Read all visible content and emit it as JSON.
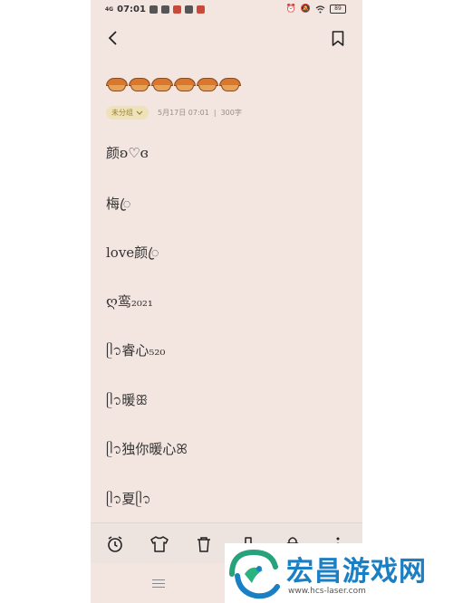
{
  "status_bar": {
    "network": "4G",
    "time": "07:01",
    "battery": "89"
  },
  "note": {
    "folder": "未分组",
    "date": "5月17日 07:01",
    "separator": "|",
    "word_count": "300字",
    "lines": [
      "颜ʚ♡ɞ",
      "梅ꦿ",
      "love颜ꦿ",
      "ღ鸾₂₀₂₁",
      "ᥫ᭡睿心₅₂₀",
      "ᥫ᭡暖ꕥ",
      "ᥫ᭡独你暖心ꕤ",
      "ᥫ᭡夏ᥫ᭡"
    ]
  },
  "watermark": {
    "title": "宏昌游戏网",
    "url": "www.hcs-laser.com"
  },
  "colors": {
    "background": "#f3e6e1",
    "folder_chip": "#efe2b8",
    "watermark_blue": "#1b7fc4"
  }
}
